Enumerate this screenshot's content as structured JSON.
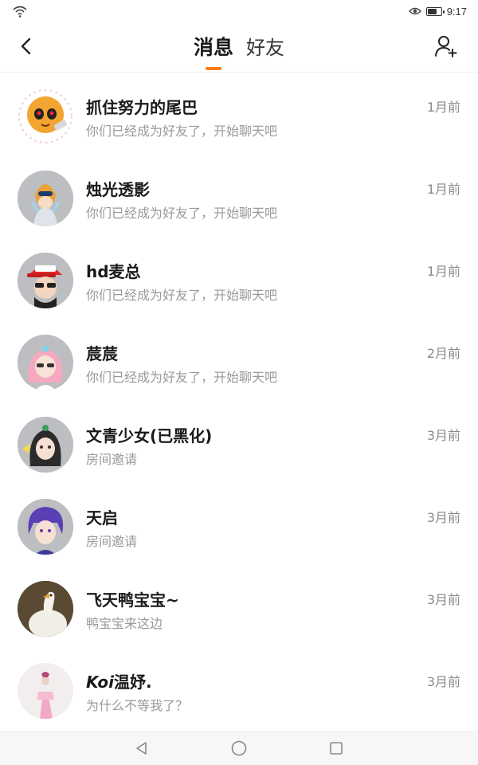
{
  "status_bar": {
    "time": "9:17",
    "battery_level": 0.75
  },
  "header": {
    "tabs": [
      {
        "label": "消息",
        "active": true
      },
      {
        "label": "好友",
        "active": false
      }
    ],
    "accent_color": "#ff7a1a"
  },
  "conversations": [
    {
      "name": "抓住努力的尾巴",
      "preview": "你们已经成为好友了，开始聊天吧",
      "time": "1月前"
    },
    {
      "name": "烛光透影",
      "preview": "你们已经成为好友了，开始聊天吧",
      "time": "1月前"
    },
    {
      "name": "hd麦总",
      "preview": "你们已经成为好友了，开始聊天吧",
      "time": "1月前"
    },
    {
      "name": "莀莀",
      "preview": "你们已经成为好友了，开始聊天吧",
      "time": "2月前"
    },
    {
      "name": "文青少女(已黑化)",
      "preview": "房间邀请",
      "time": "3月前"
    },
    {
      "name": "天启",
      "preview": "房间邀请",
      "time": "3月前"
    },
    {
      "name": "飞天鸭宝宝~",
      "preview": "鸭宝宝来这边",
      "time": "3月前"
    },
    {
      "name_italic": "Koi",
      "name_rest": "温妤.",
      "preview": "为什么不等我了？",
      "time": "3月前"
    }
  ],
  "icons": {
    "back": "chevron-left-icon",
    "add_friend": "person-add-icon",
    "nav_back": "triangle-back-icon",
    "nav_home": "circle-home-icon",
    "nav_recents": "square-recents-icon"
  }
}
